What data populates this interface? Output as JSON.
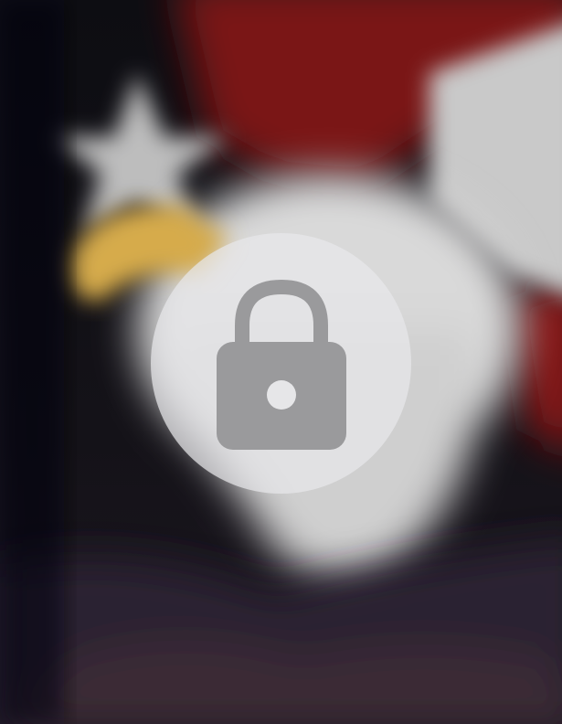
{
  "wallpaper": {
    "icon": "blurred-eagle-flag-wallpaper",
    "colors": {
      "dark": "#0b0b0e",
      "red": "#7a1216",
      "white": "#d8d8d8",
      "beak": "#d6ab4c",
      "feathers": "#2a2430"
    }
  },
  "lock_overlay": {
    "icon": "lock-icon",
    "colors": {
      "circle": "#e8e8ea",
      "glyph": "#9a9a9c"
    }
  }
}
